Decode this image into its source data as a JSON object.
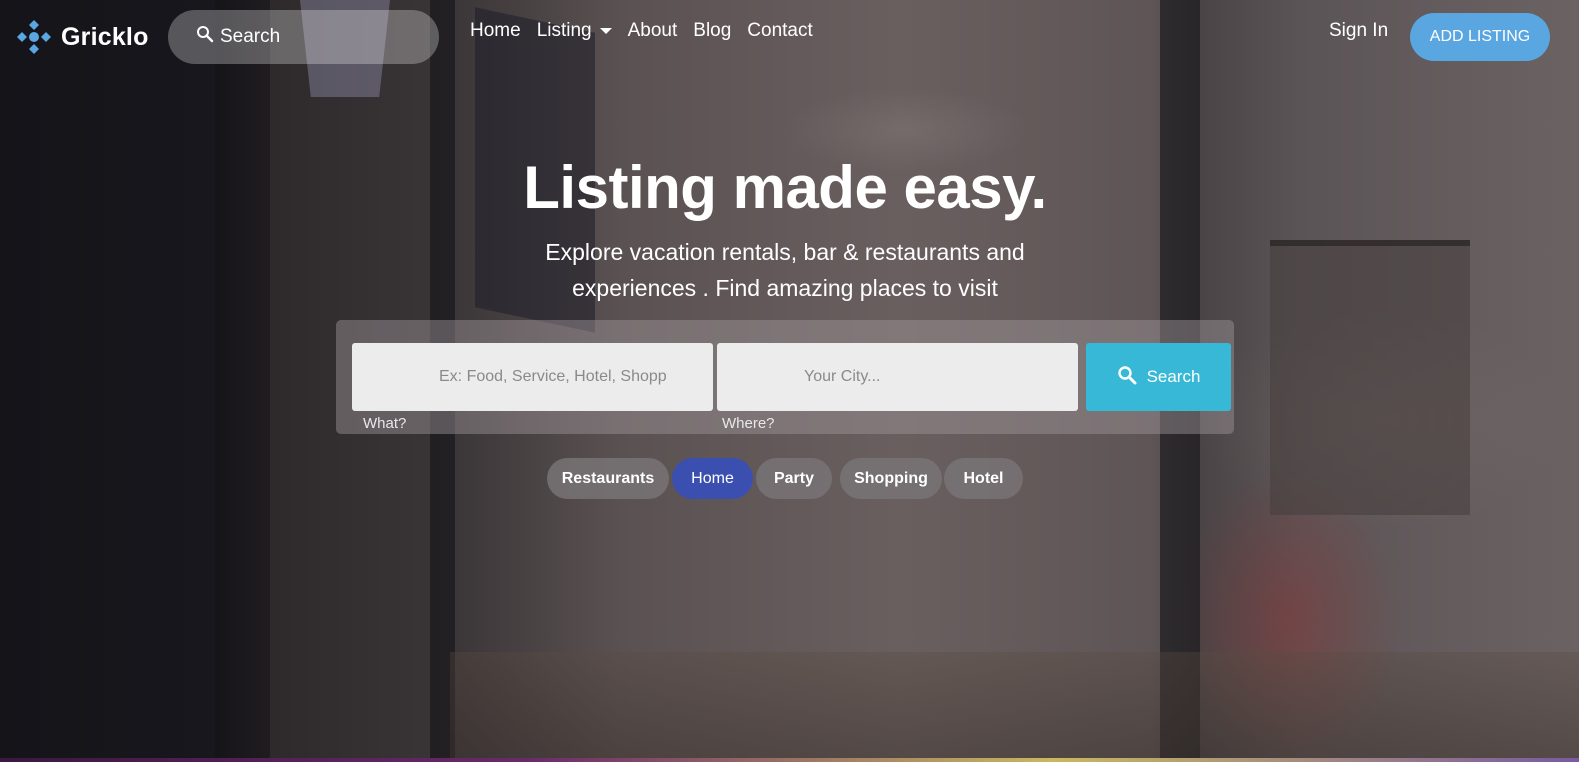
{
  "brand": {
    "name": "Gricklo"
  },
  "nav": {
    "search_label": "Search",
    "links": [
      "Home",
      "Listing",
      "About",
      "Blog",
      "Contact"
    ],
    "sign_in": "Sign In",
    "add_listing": "ADD LISTING"
  },
  "hero": {
    "title": "Listing made easy.",
    "subtitle": "Explore vacation rentals, bar & restaurants and experiences . Find amazing places to visit"
  },
  "search": {
    "what_placeholder": "Ex: Food, Service, Hotel, Shopp",
    "where_placeholder": "Your City...",
    "what_label": "What?",
    "where_label": "Where?",
    "button_label": "Search"
  },
  "categories": [
    {
      "label": "Restaurants",
      "active": false
    },
    {
      "label": "Home",
      "active": true
    },
    {
      "label": "Party",
      "active": false
    },
    {
      "label": "Shopping",
      "active": false
    },
    {
      "label": "Hotel",
      "active": false
    }
  ],
  "colors": {
    "add_listing_bg": "#5aa6e0",
    "search_button_bg": "#36b8d6",
    "active_chip_bg": "#3b4fb0",
    "logo_accent": "#5aa6e0"
  }
}
